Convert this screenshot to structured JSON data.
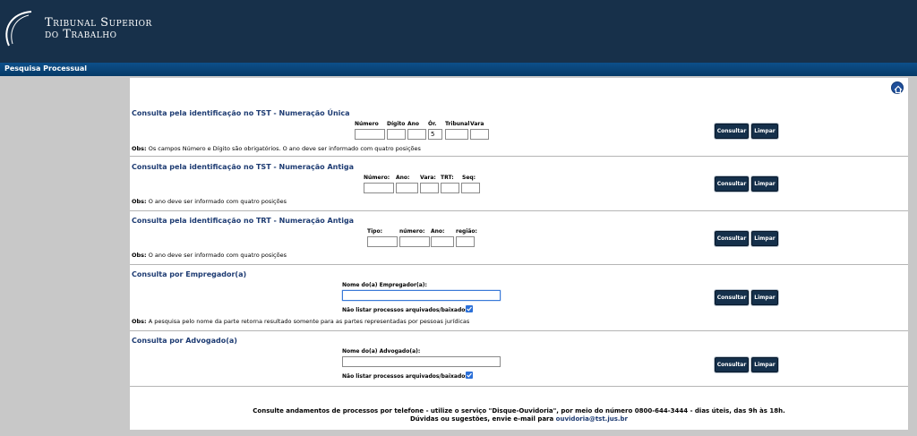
{
  "header": {
    "logo_line1": "Tribunal Superior",
    "logo_line2": "do Trabalho"
  },
  "nav": {
    "title": "Pesquisa Processual"
  },
  "buttons": {
    "consultar": "Consultar",
    "limpar": "Limpar"
  },
  "section1": {
    "title": "Consulta pela identificação no TST - Numeração Única",
    "labels": [
      "Número",
      "Dígito",
      "Ano",
      "Ór.",
      "Tribunal",
      "Vara"
    ],
    "orgao_value": "5",
    "obs_label": "Obs:",
    "obs_text": " Os campos Número e Dígito são obrigatórios. O ano deve ser informado com quatro posições"
  },
  "section2": {
    "title": "Consulta pela identificação no TST - Numeração Antiga",
    "labels": [
      "Número:",
      "Ano:",
      "Vara:",
      "TRT:",
      "Seq:"
    ],
    "obs_label": "Obs:",
    "obs_text": " O ano deve ser informado com quatro posições"
  },
  "section3": {
    "title": "Consulta pela identificação no TRT - Numeração Antiga",
    "labels": [
      "Tipo:",
      "número:",
      "Ano:",
      "região:"
    ],
    "obs_label": "Obs:",
    "obs_text": " O ano deve ser informado com quatro posições"
  },
  "section4": {
    "title": "Consulta por Empregador(a)",
    "field_label": "Nome do(a) Empregador(a):",
    "checkbox_label": "Não listar processos arquivados/baixados",
    "obs_label": "Obs:",
    "obs_text": " A pesquisa pelo nome da parte retorna resultado somente para as partes representadas por pessoas jurídicas"
  },
  "section5": {
    "title": "Consulta por Advogado(a)",
    "field_label": "Nome do(a) Advogado(a):",
    "checkbox_label": "Não listar processos arquivados/baixados"
  },
  "footer": {
    "line1": "Consulte andamentos de processos por telefone - utilize o serviço \"Disque-Ouvidoria\", por meio do número 0800-644-3444 - dias úteis, das 9h às 18h.",
    "line2_prefix": "Dúvidas ou sugestões, envie e-mail para ",
    "email": "ouvidoria@tst.jus.br"
  },
  "colors": {
    "header_bg": "#17304a",
    "nav_bg": "#0d4f8a",
    "title_blue": "#1d3b72",
    "button_bg": "#15304b",
    "checkbox": "#2c70d8"
  }
}
